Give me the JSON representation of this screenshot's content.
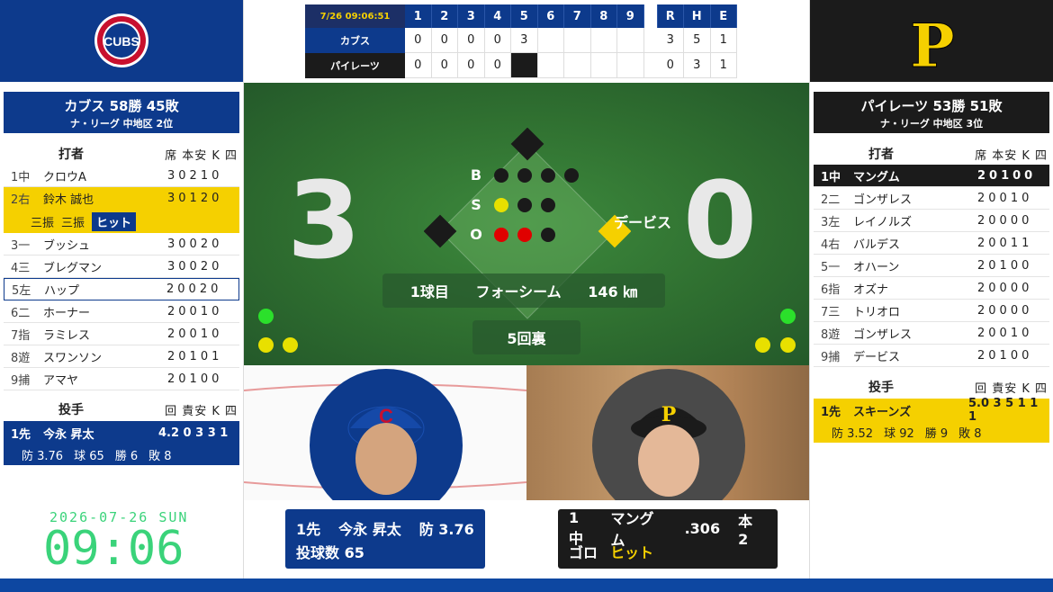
{
  "linescore": {
    "datetime": "7/26 09:06:51",
    "innings": [
      "1",
      "2",
      "3",
      "4",
      "5",
      "6",
      "7",
      "8",
      "9"
    ],
    "rhe_headers": [
      "R",
      "H",
      "E"
    ],
    "away": {
      "name": "カブス",
      "innings": [
        "0",
        "0",
        "0",
        "0",
        "3",
        "",
        "",
        "",
        ""
      ],
      "r": "3",
      "h": "5",
      "e": "1"
    },
    "home": {
      "name": "パイレーツ",
      "innings": [
        "0",
        "0",
        "0",
        "0",
        "",
        "",
        "",
        "",
        ""
      ],
      "r": "0",
      "h": "3",
      "e": "1"
    }
  },
  "away": {
    "logo_text": "CUBS",
    "record": "カブス 58勝 45敗",
    "standing": "ナ・リーグ 中地区 2位",
    "lineup_title": "打者",
    "lineup_cols": "席 本安 K 四",
    "lineup": [
      {
        "pos": "1中",
        "name": "クロウA",
        "stats": "30210"
      },
      {
        "pos": "2右",
        "name": "鈴木 誠也",
        "stats": "30120"
      },
      {
        "pos": "3一",
        "name": "ブッシュ",
        "stats": "30020"
      },
      {
        "pos": "4三",
        "name": "ブレグマン",
        "stats": "30020"
      },
      {
        "pos": "5左",
        "name": "ハップ",
        "stats": "20020"
      },
      {
        "pos": "6二",
        "name": "ホーナー",
        "stats": "20010"
      },
      {
        "pos": "7指",
        "name": "ラミレス",
        "stats": "20010"
      },
      {
        "pos": "8遊",
        "name": "スワンソン",
        "stats": "20101"
      },
      {
        "pos": "9捕",
        "name": "アマヤ",
        "stats": "20100"
      }
    ],
    "history": [
      "三振",
      "三振",
      "ヒット"
    ],
    "pitcher_title": "投手",
    "pitcher_cols": "回 責安 K 四",
    "pitcher": {
      "pos": "1先",
      "name": "今永 昇太",
      "stats": "4.2 0 3 3 1",
      "era": "防 3.76",
      "pitches": "球 65",
      "wins": "勝 6",
      "losses": "敗 8"
    }
  },
  "home": {
    "logo_text": "P",
    "record": "パイレーツ 53勝 51敗",
    "standing": "ナ・リーグ 中地区 3位",
    "lineup_title": "打者",
    "lineup_cols": "席 本安 K 四",
    "lineup": [
      {
        "pos": "1中",
        "name": "マングム",
        "stats": "20100"
      },
      {
        "pos": "2二",
        "name": "ゴンザレス",
        "stats": "20010"
      },
      {
        "pos": "3左",
        "name": "レイノルズ",
        "stats": "20000"
      },
      {
        "pos": "4右",
        "name": "バルデス",
        "stats": "20011"
      },
      {
        "pos": "5一",
        "name": "オハーン",
        "stats": "20100"
      },
      {
        "pos": "6指",
        "name": "オズナ",
        "stats": "20000"
      },
      {
        "pos": "7三",
        "name": "トリオロ",
        "stats": "20000"
      },
      {
        "pos": "8遊",
        "name": "ゴンザレス",
        "stats": "20010"
      },
      {
        "pos": "9捕",
        "name": "デービス",
        "stats": "20100"
      }
    ],
    "pitcher_title": "投手",
    "pitcher_cols": "回 責安 K 四",
    "pitcher": {
      "pos": "1先",
      "name": "スキーンズ",
      "stats": "5.0 3 5 1 1 1",
      "era": "防 3.52",
      "pitches": "球 92",
      "wins": "勝 9",
      "losses": "敗 8"
    }
  },
  "field": {
    "score_away": "3",
    "score_home": "0",
    "bso_labels": [
      "B",
      "S",
      "O"
    ],
    "balls": 0,
    "strikes": 1,
    "outs": 2,
    "runner_name": "デービス",
    "pitch_count": "1球目",
    "pitch_type": "フォーシーム",
    "pitch_speed": "146 ㎞",
    "inning": "5回裏"
  },
  "cards": {
    "pitcher": {
      "pos": "1先",
      "name": "今永 昇太",
      "era": "防 3.76",
      "line2": "投球数 65"
    },
    "batter": {
      "pos": "1中",
      "name": "マングム",
      "avg": ".306",
      "hr": "本 2",
      "result1": "ゴロ",
      "result2": "ヒット"
    }
  },
  "clock": {
    "date": "2026-07-26 SUN",
    "time": "09:06"
  },
  "colors": {
    "cubs_blue": "#0d3a8c",
    "pirates_black": "#1b1b1b",
    "pirates_gold": "#f5d000",
    "field_green": "#2f6f30",
    "clock_green": "#3ad37a"
  }
}
